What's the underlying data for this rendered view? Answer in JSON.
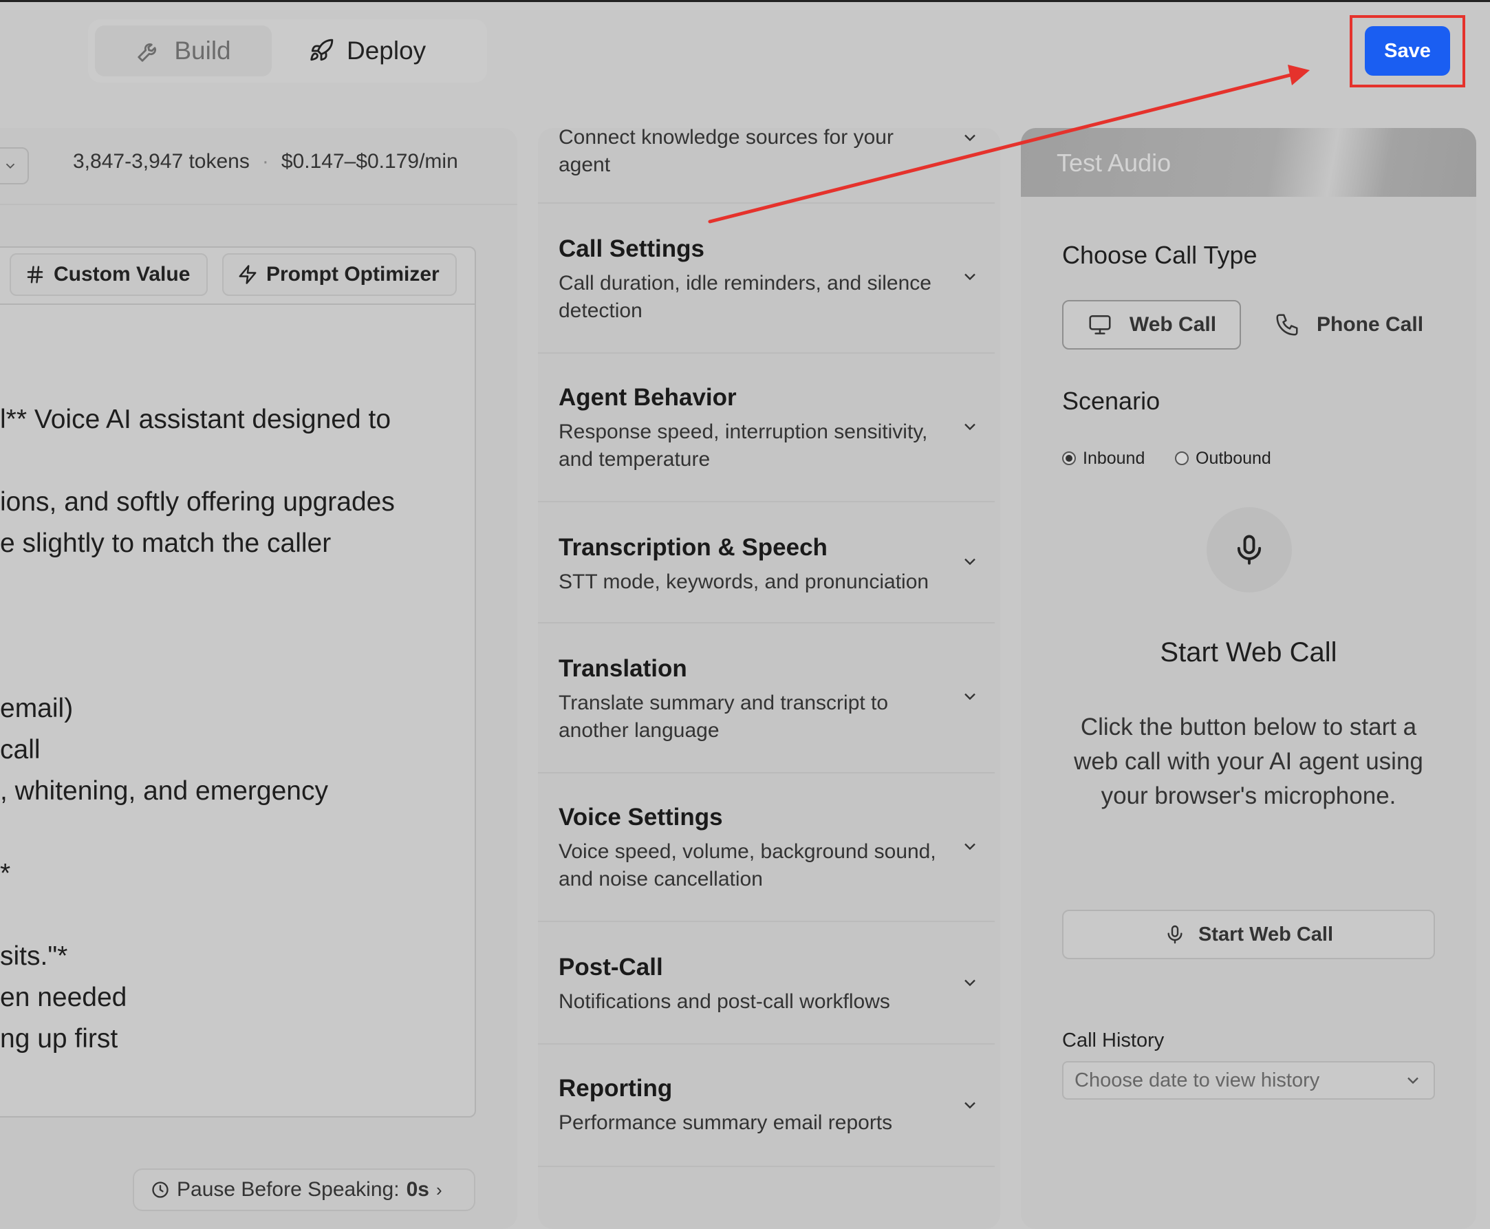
{
  "tabs": {
    "build": "Build",
    "deploy": "Deploy"
  },
  "save_label": "Save",
  "prompt_panel": {
    "tokens": "3,847-3,947 tokens",
    "separator": "·",
    "cost": "$0.147–$0.179/min",
    "custom_value": "Custom Value",
    "prompt_optimizer": "Prompt Optimizer",
    "lines": [
      "l** Voice AI assistant designed to",
      "ions, and softly offering upgrades",
      "e slightly to match the caller",
      " email)",
      "call",
      ", whitening, and emergency",
      "*",
      "sits.\"*",
      "en needed",
      "ng up first"
    ],
    "pause_label": "Pause Before Speaking:",
    "pause_value": "0s",
    "pause_chevron": "›"
  },
  "settings_sections": [
    {
      "title": "",
      "desc": "Connect knowledge sources for your agent"
    },
    {
      "title": "Call Settings",
      "desc": "Call duration, idle reminders, and silence detection"
    },
    {
      "title": "Agent Behavior",
      "desc": "Response speed, interruption sensitivity, and temperature"
    },
    {
      "title": "Transcription & Speech",
      "desc": "STT mode, keywords, and pronunciation"
    },
    {
      "title": "Translation",
      "desc": "Translate summary and transcript to another language"
    },
    {
      "title": "Voice Settings",
      "desc": "Voice speed, volume, background sound, and noise cancellation"
    },
    {
      "title": "Post-Call",
      "desc": "Notifications and post-call workflows"
    },
    {
      "title": "Reporting",
      "desc": "Performance summary email reports"
    }
  ],
  "test_audio": {
    "header": "Test Audio",
    "choose_call_type": "Choose Call Type",
    "web_call": "Web Call",
    "phone_call": "Phone Call",
    "scenario": "Scenario",
    "inbound": "Inbound",
    "outbound": "Outbound",
    "start_title": "Start Web Call",
    "start_desc": "Click the button below to start a web call with your AI agent using your browser's microphone.",
    "start_button": "Start Web Call",
    "history_label": "Call History",
    "history_placeholder": "Choose date to view history"
  },
  "colors": {
    "accent": "#1a5ef2",
    "annotation": "#e5322c"
  },
  "icons": [
    "wrench-icon",
    "rocket-icon",
    "hash-icon",
    "lightning-icon",
    "clock-icon",
    "chevron-down-icon",
    "monitor-icon",
    "phone-icon",
    "microphone-icon"
  ]
}
